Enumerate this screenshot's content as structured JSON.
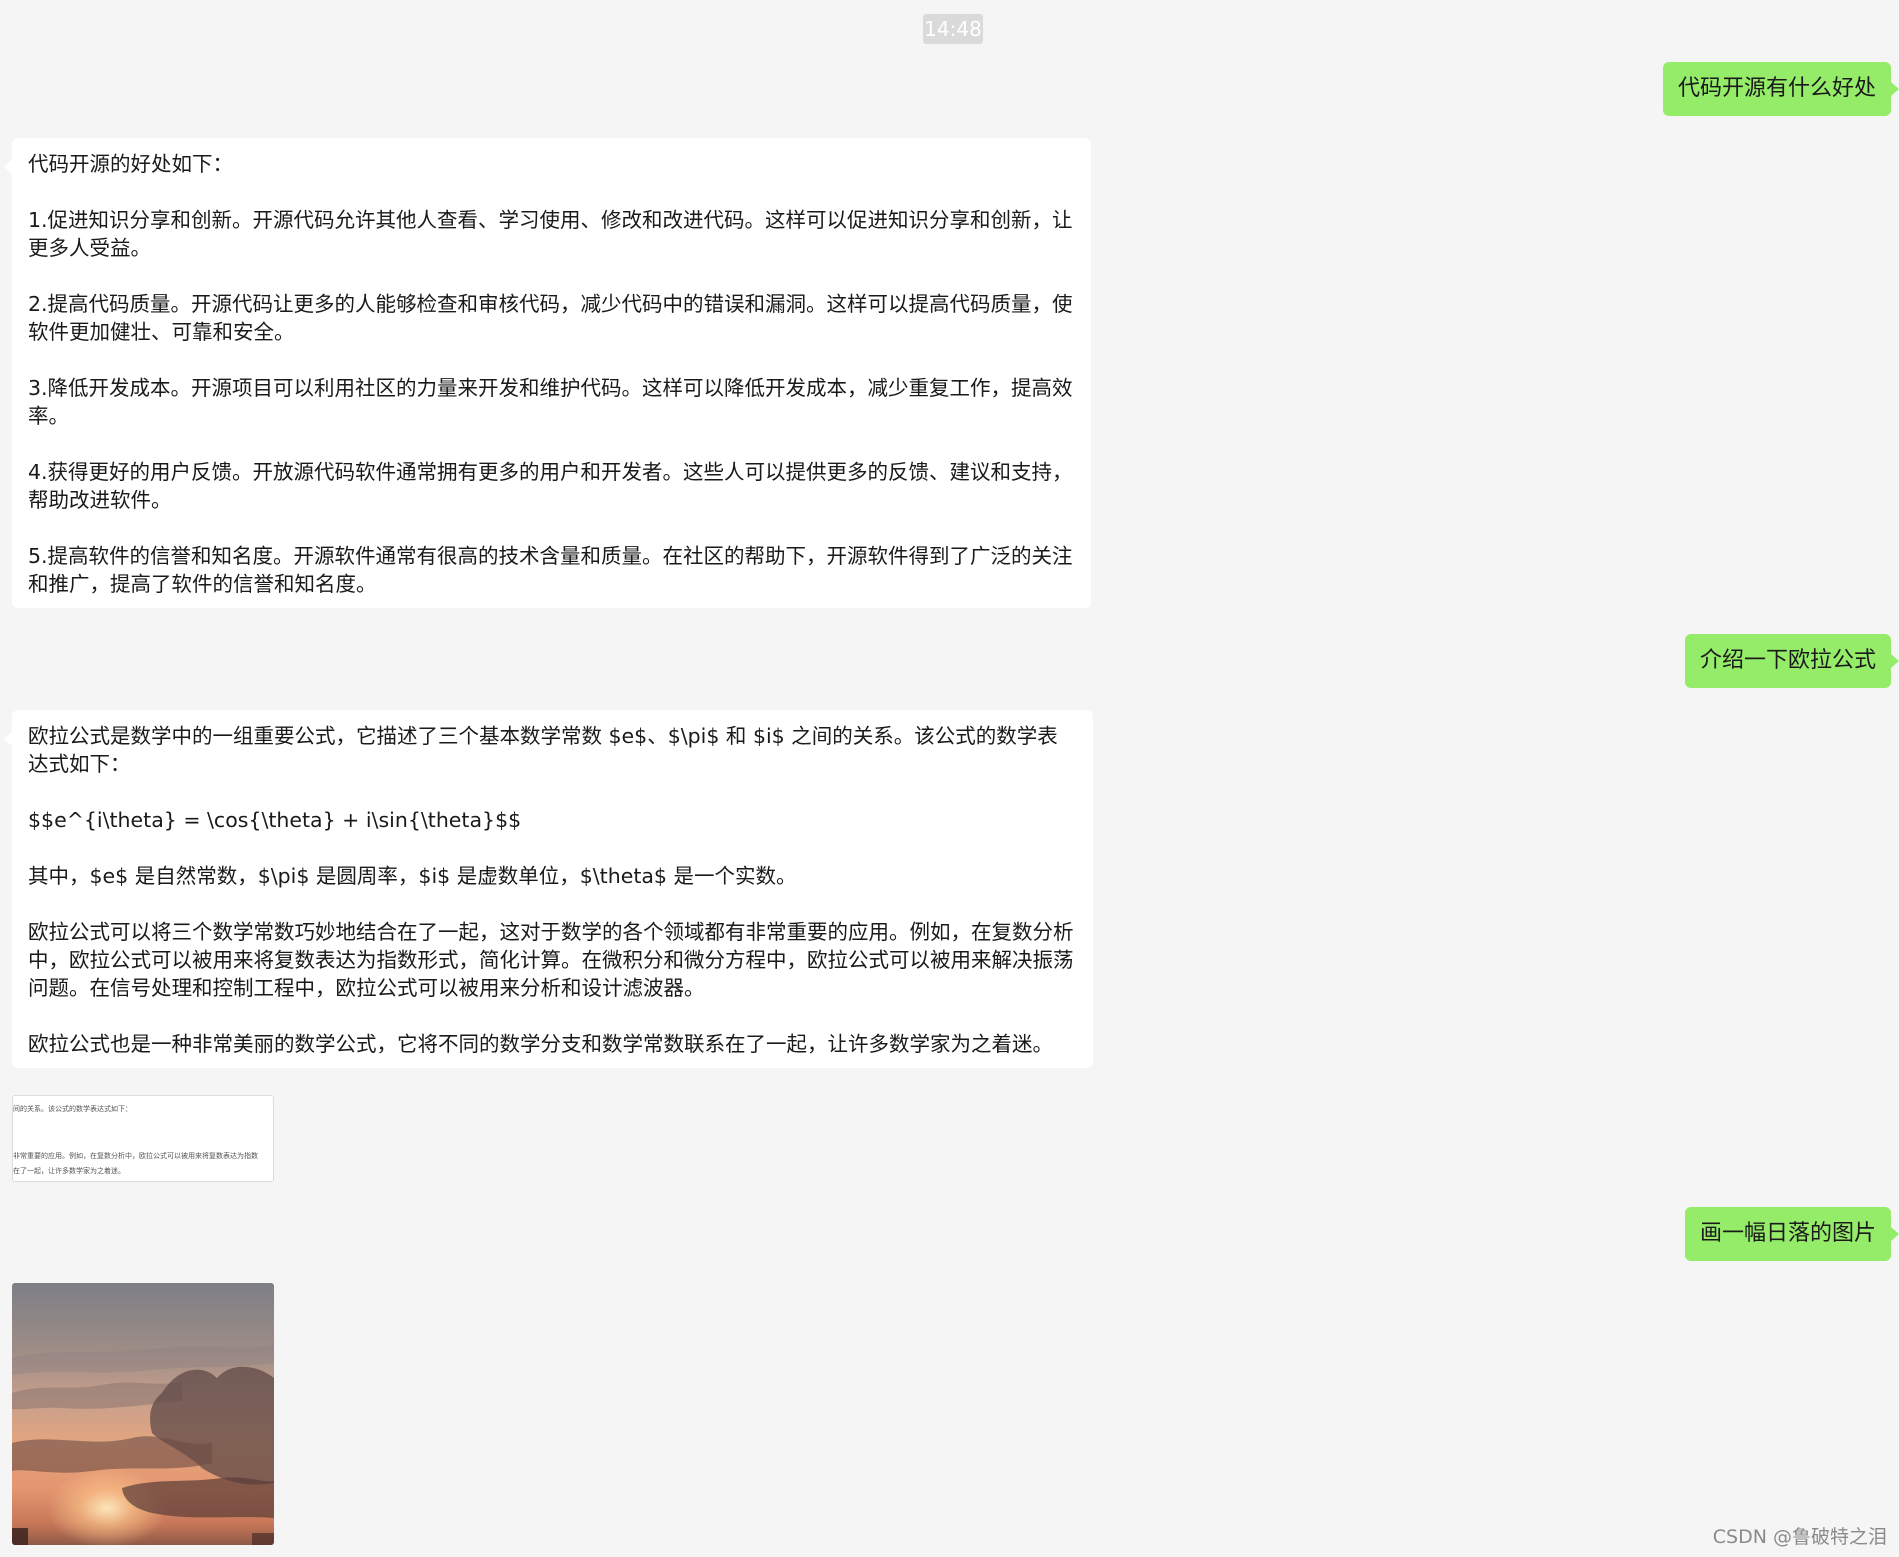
{
  "timestamp": "14:48",
  "messages": {
    "q1": "代码开源有什么好处",
    "a1": [
      "代码开源的好处如下：",
      "1.促进知识分享和创新。开源代码允许其他人查看、学习使用、修改和改进代码。这样可以促进知识分享和创新，让更多人受益。",
      "2.提高代码质量。开源代码让更多的人能够检查和审核代码，减少代码中的错误和漏洞。这样可以提高代码质量，使软件更加健壮、可靠和安全。",
      "3.降低开发成本。开源项目可以利用社区的力量来开发和维护代码。这样可以降低开发成本，减少重复工作，提高效率。",
      "4.获得更好的用户反馈。开放源代码软件通常拥有更多的用户和开发者。这些人可以提供更多的反馈、建议和支持，帮助改进软件。",
      "5.提高软件的信誉和知名度。开源软件通常有很高的技术含量和质量。在社区的帮助下，开源软件得到了广泛的关注和推广，提高了软件的信誉和知名度。"
    ],
    "q2": "介绍一下欧拉公式",
    "a2": [
      "欧拉公式是数学中的一组重要公式，它描述了三个基本数学常数 $e$、$\\pi$ 和 $i$ 之间的关系。该公式的数学表达式如下：",
      "$$e^{i\\theta} = \\cos{\\theta} + i\\sin{\\theta}$$",
      "其中，$e$ 是自然常数，$\\pi$ 是圆周率，$i$ 是虚数单位，$\\theta$ 是一个实数。",
      "欧拉公式可以将三个数学常数巧妙地结合在了一起，这对于数学的各个领域都有非常重要的应用。例如，在复数分析中，欧拉公式可以被用来将复数表达为指数形式，简化计算。在微积分和微分方程中，欧拉公式可以被用来解决振荡问题。在信号处理和控制工程中，欧拉公式可以被用来分析和设计滤波器。",
      "欧拉公式也是一种非常美丽的数学公式，它将不同的数学分支和数学常数联系在了一起，让许多数学家为之着迷。"
    ],
    "thumb_lines": [
      "间的关系。该公式的数学表达式如下：",
      "非常重要的应用。例如，在复数分析中，欧拉公式可以被用来将复数表达为指数",
      "在了一起，让许多数学家为之着迷。"
    ],
    "q3": "画一幅日落的图片"
  },
  "watermark": "CSDN @鲁破特之泪",
  "colors": {
    "background": "#f5f5f5",
    "user_bubble": "#95ec69",
    "bot_bubble": "#ffffff",
    "timestamp_bg": "#dadada"
  }
}
